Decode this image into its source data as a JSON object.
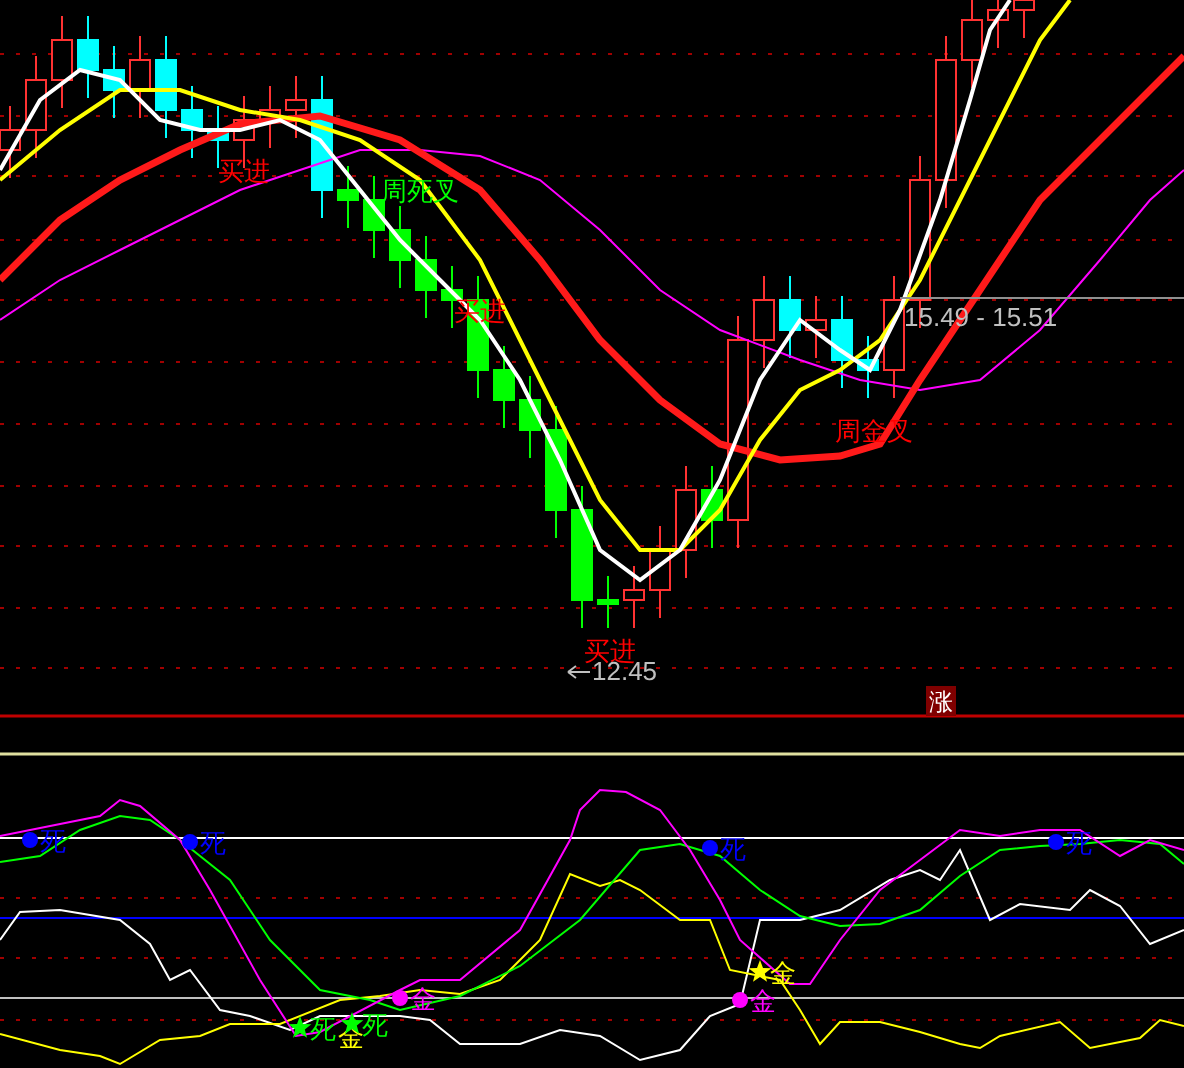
{
  "price_chart": {
    "signals": [
      {
        "text": "买进",
        "color": "#ff0000"
      },
      {
        "text": "周死叉",
        "color": "#00ff00"
      },
      {
        "text": "买进",
        "color": "#ff0000"
      },
      {
        "text": "买进",
        "color": "#ff0000"
      },
      {
        "text": "周金叉",
        "color": "#ff0000"
      }
    ],
    "range_label": "15.49 - 15.51",
    "low_label": "12.45",
    "badge": "涨"
  },
  "indicator_chart": {
    "signals": [
      {
        "text": "死",
        "color": "#0000ff",
        "kind": "dot"
      },
      {
        "text": "死",
        "color": "#0000ff",
        "kind": "dot"
      },
      {
        "text": "死",
        "color": "#00ff00",
        "kind": "star"
      },
      {
        "text": "金",
        "color": "#ffff00",
        "kind": "none"
      },
      {
        "text": "死",
        "color": "#00ff00",
        "kind": "star"
      },
      {
        "text": "金",
        "color": "#ff00ff",
        "kind": "dot"
      },
      {
        "text": "死",
        "color": "#0000ff",
        "kind": "dot"
      },
      {
        "text": "金",
        "color": "#ffff00",
        "kind": "star"
      },
      {
        "text": "金",
        "color": "#ff00ff",
        "kind": "dot"
      },
      {
        "text": "死",
        "color": "#0000ff",
        "kind": "dot"
      }
    ]
  }
}
